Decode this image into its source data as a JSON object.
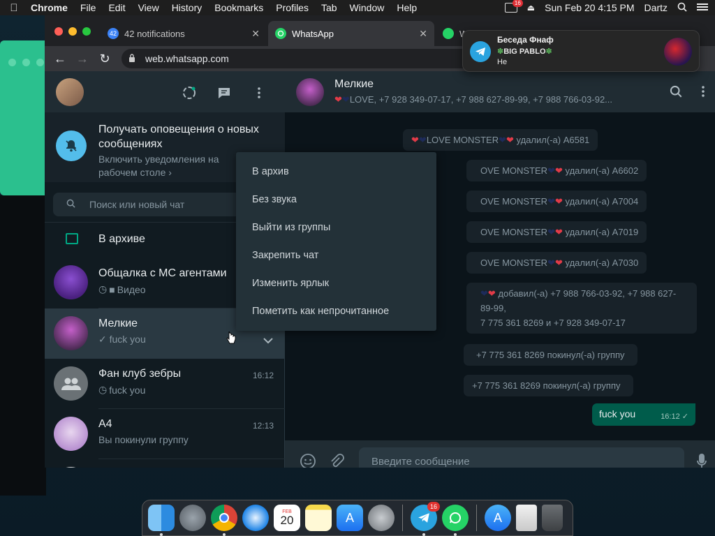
{
  "menubar": {
    "app": "Chrome",
    "items": [
      "File",
      "Edit",
      "View",
      "History",
      "Bookmarks",
      "Profiles",
      "Tab",
      "Window",
      "Help"
    ],
    "status_badge": "16",
    "datetime": "Sun Feb 20  4:15 PM",
    "user": "Dartz"
  },
  "browser": {
    "tabs": [
      {
        "label": "42 notifications",
        "favicon_badge": "42",
        "active": false
      },
      {
        "label": "WhatsApp",
        "active": true
      },
      {
        "label": "W",
        "active": false
      }
    ],
    "url": "web.whatsapp.com"
  },
  "sidebar": {
    "notify": {
      "title": "Получать оповещения о новых сообщениях",
      "subtitle": "Включить уведомления на рабочем столе ›"
    },
    "search_placeholder": "Поиск или новый чат",
    "archive_label": "В архиве",
    "chats": [
      {
        "name": "Общалка с МС агентами",
        "preview": "Видео",
        "time": "",
        "preview_icon": "video-icon"
      },
      {
        "name": "Мелкие",
        "preview": "✓ fuck you",
        "time": "",
        "selected": true
      },
      {
        "name": "Фан клуб зебры",
        "preview": "fuck you",
        "time": "16:12"
      },
      {
        "name": "А4",
        "preview": "Вы покинули группу",
        "time": "12:13"
      }
    ]
  },
  "conversation": {
    "title": "Мелкие",
    "subtitle": "LOVE, +7 928 349-07-17, +7 988 627-89-99, +7 988 766-03-92...",
    "system_messages": [
      {
        "text": "LOVE MONSTER",
        "suffix": "удалил(-а) А6581"
      },
      {
        "text": "OVE MONSTER",
        "suffix": "удалил(-а) А6602"
      },
      {
        "text": "OVE MONSTER",
        "suffix": "удалил(-а) А7004"
      },
      {
        "text": "OVE MONSTER",
        "suffix": "удалил(-а) А7019"
      },
      {
        "text": "OVE MONSTER",
        "suffix": "удалил(-а) А7030"
      }
    ],
    "added_msg_l1": "добавил(-а) +7 988 766-03-92, +7 988 627-89-99,",
    "added_msg_l2": "7 775 361 8269 и +7 928 349-07-17",
    "left_msg_1": "+7 775 361 8269 покинул(-а) группу",
    "left_msg_2": "+7 775 361 8269 покинул(-а) группу",
    "outgoing": {
      "text": "fuck you",
      "time": "16:12"
    },
    "composer_placeholder": "Введите сообщение"
  },
  "context_menu": {
    "items": [
      "В архив",
      "Без звука",
      "Выйти из группы",
      "Закрепить чат",
      "Изменить ярлык",
      "Пометить как непрочитанное"
    ]
  },
  "telegram_notification": {
    "title": "Беседа Фнаф",
    "sender": "BIG PABLO",
    "message": "Не"
  },
  "dock": {
    "apps": [
      "finder-icon",
      "launchpad-icon",
      "chrome-icon",
      "safari-icon",
      "calendar-icon",
      "notes-icon",
      "app-store-icon",
      "system-preferences-icon",
      "telegram-icon",
      "whatsapp-icon",
      "app-store-folder-icon",
      "downloads-icon",
      "trash-icon"
    ],
    "calendar_month": "FEB",
    "calendar_day": "20",
    "telegram_badge": "16"
  },
  "colors": {
    "whatsapp_green": "#00a884",
    "outgoing_bubble": "#005c4b",
    "panel": "#202c33",
    "telegram_blue": "#2aa3df"
  }
}
